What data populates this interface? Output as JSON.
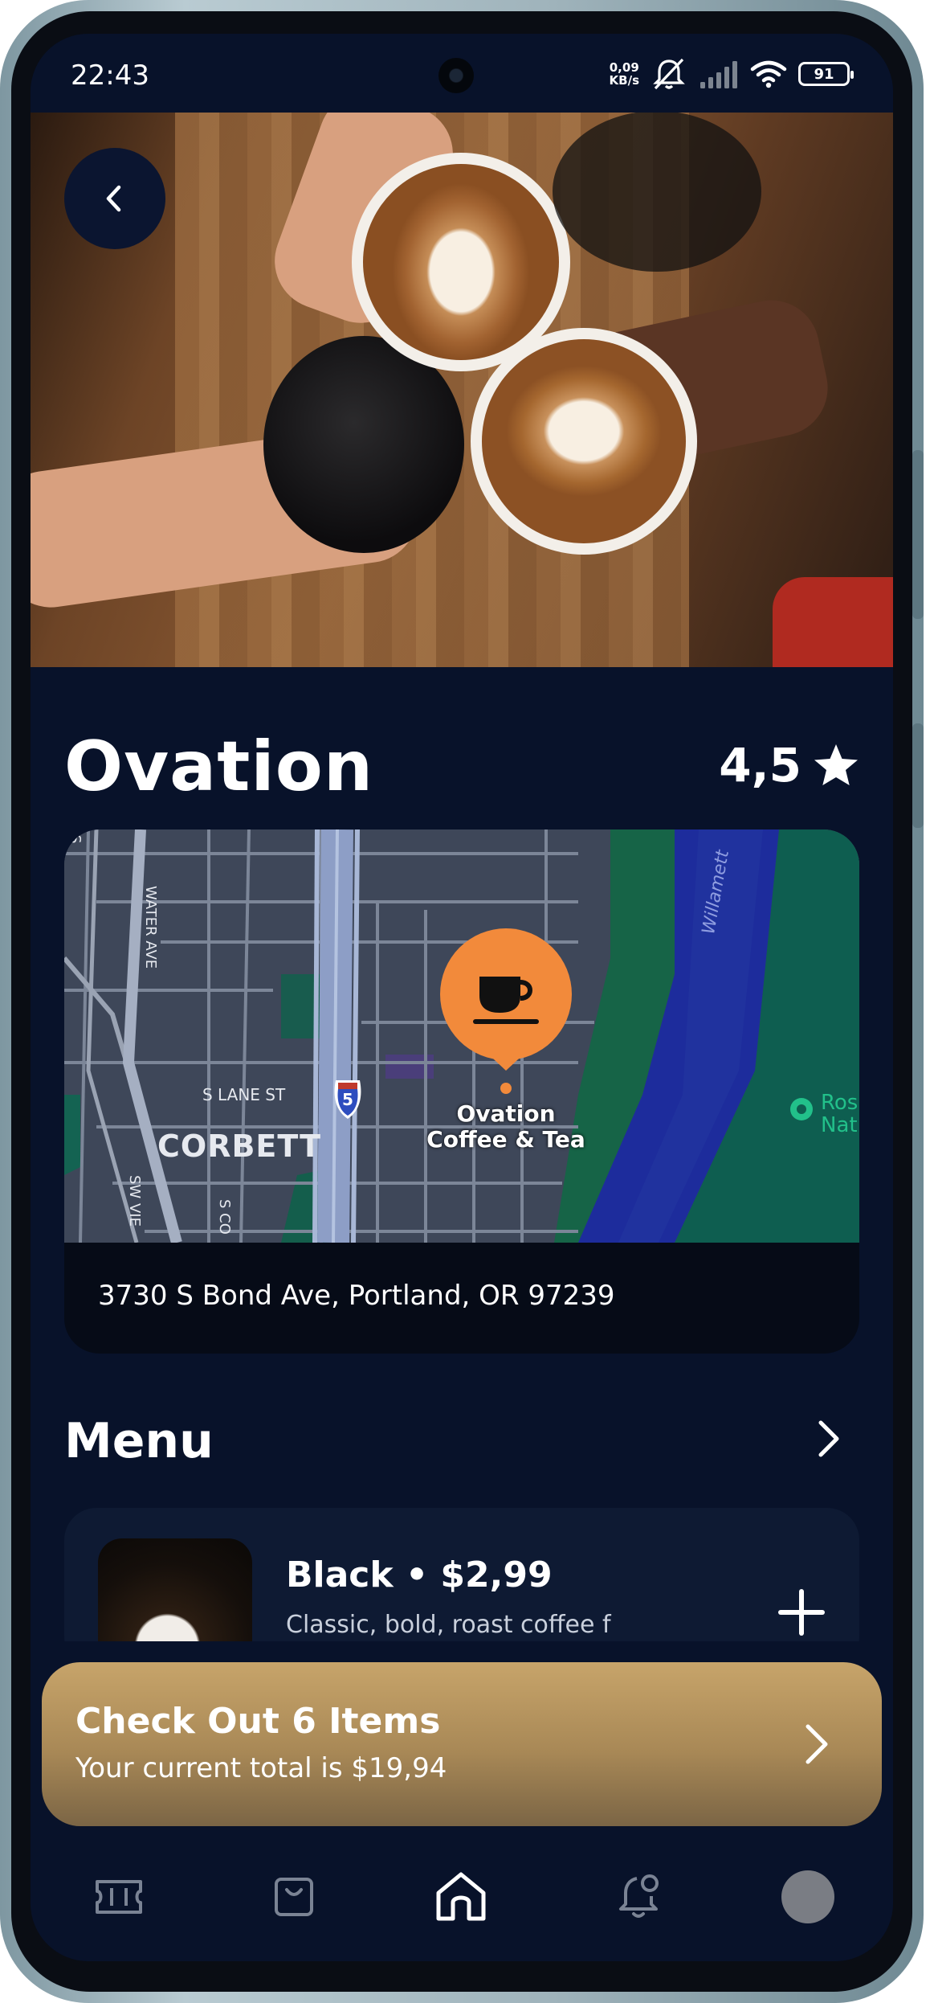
{
  "status_bar": {
    "time": "22:43",
    "net_speed_value": "0,09",
    "net_speed_unit": "KB/s",
    "battery": "91",
    "icons": [
      "mute-icon",
      "signal-icon",
      "wifi-icon",
      "battery-icon"
    ]
  },
  "shop": {
    "name": "Ovation",
    "rating": "4,5",
    "address": "3730 S Bond Ave, Portland, OR 97239"
  },
  "map": {
    "pin_label_line1": "Ovation",
    "pin_label_line2": "Coffee & Tea",
    "district": "CORBETT",
    "street_lane": "S LANE ST",
    "street_water": "WATER AVE",
    "street_sw": "SW VIE",
    "street_sc": "S CO",
    "river": "Willamett",
    "poi_line1": "Ros",
    "poi_line2": "Nat",
    "highway": "5",
    "corner_label": "S"
  },
  "menu": {
    "title": "Menu",
    "items": [
      {
        "name": "Black • $2,99",
        "description": "Classic, bold, roast coffee f"
      }
    ]
  },
  "checkout": {
    "title": "Check Out 6 Items",
    "subtitle": "Your current total is $19,94"
  },
  "nav": {
    "items": [
      "ticket-icon",
      "bag-icon",
      "home-icon",
      "bell-icon",
      "profile-avatar"
    ],
    "active": "home-icon"
  },
  "colors": {
    "background": "#08122a",
    "card": "#0e1a33",
    "accent_gold": "#b8955f",
    "map_pin": "#f28a3b",
    "river": "#1f2f9e",
    "park": "#0f5e52"
  }
}
